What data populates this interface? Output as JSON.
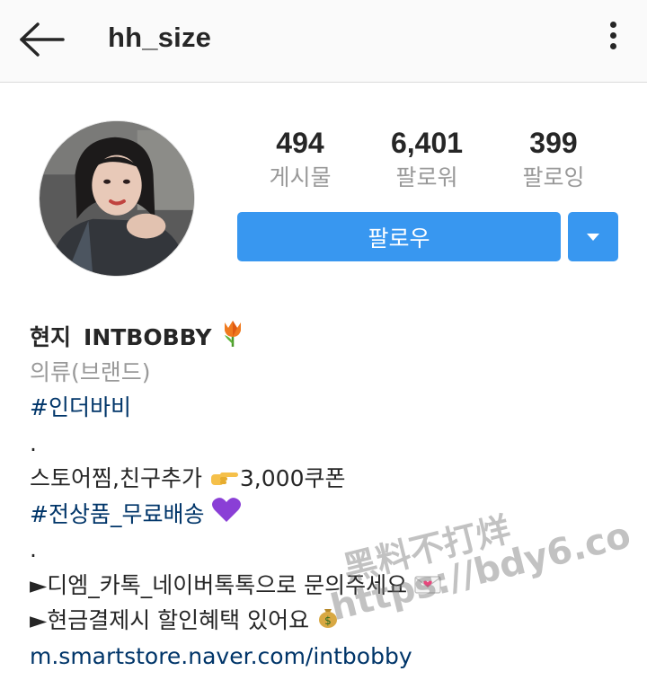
{
  "header": {
    "username": "hh_size",
    "back_icon": "arrow-left-icon",
    "more_icon": "more-vertical-icon"
  },
  "profile": {
    "stats": [
      {
        "value": "494",
        "label": "게시물"
      },
      {
        "value": "6,401",
        "label": "팔로워"
      },
      {
        "value": "399",
        "label": "팔로잉"
      }
    ],
    "follow_label": "팔로우",
    "dropdown_icon": "caret-down-icon"
  },
  "bio": {
    "name": "현지",
    "brand": "INTBOBBY",
    "category": "의류(브랜드)",
    "hashtag1": "#인더바비",
    "dot1": ".",
    "coupon_text1": "스토어찜,친구추가",
    "coupon_text2": "3,000쿠폰",
    "hashtag2": "#전상품_무료배송",
    "dot2": ".",
    "bullet1": "►디엠_카톡_네이버톡톡으로 문의주세요",
    "bullet2": "►현금결제시 할인혜택 있어요",
    "link": "m.smartstore.naver.com/intbobby"
  },
  "watermark": {
    "line1": "黑料不打烊",
    "line2": "https://bdy6.co"
  },
  "colors": {
    "accent": "#3897f0",
    "hashtag": "#003569",
    "muted": "#999999",
    "text": "#262626"
  }
}
